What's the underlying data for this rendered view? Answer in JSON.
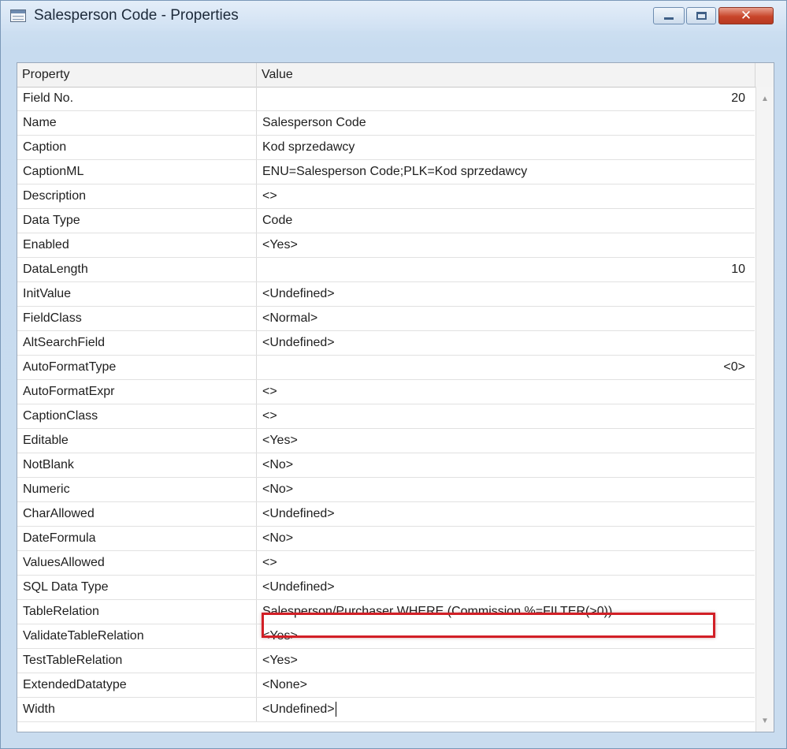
{
  "window": {
    "title": "Salesperson Code - Properties",
    "min_glyph": "minimize",
    "max_glyph": "maximize",
    "close_glyph": "✕"
  },
  "columns": {
    "property": "Property",
    "value": "Value"
  },
  "rows": [
    {
      "property": "Field No.",
      "value": "20",
      "align": "right"
    },
    {
      "property": "Name",
      "value": "Salesperson Code"
    },
    {
      "property": "Caption",
      "value": "Kod sprzedawcy"
    },
    {
      "property": "CaptionML",
      "value": "ENU=Salesperson Code;PLK=Kod sprzedawcy"
    },
    {
      "property": "Description",
      "value": "<>"
    },
    {
      "property": "Data Type",
      "value": "Code"
    },
    {
      "property": "Enabled",
      "value": "<Yes>"
    },
    {
      "property": "DataLength",
      "value": "10",
      "align": "right"
    },
    {
      "property": "InitValue",
      "value": "<Undefined>"
    },
    {
      "property": "FieldClass",
      "value": "<Normal>"
    },
    {
      "property": "AltSearchField",
      "value": "<Undefined>"
    },
    {
      "property": "AutoFormatType",
      "value": "<0>",
      "align": "right"
    },
    {
      "property": "AutoFormatExpr",
      "value": "<>"
    },
    {
      "property": "CaptionClass",
      "value": "<>"
    },
    {
      "property": "Editable",
      "value": "<Yes>"
    },
    {
      "property": "NotBlank",
      "value": "<No>"
    },
    {
      "property": "Numeric",
      "value": "<No>"
    },
    {
      "property": "CharAllowed",
      "value": "<Undefined>"
    },
    {
      "property": "DateFormula",
      "value": "<No>"
    },
    {
      "property": "ValuesAllowed",
      "value": "<>"
    },
    {
      "property": "SQL Data Type",
      "value": "<Undefined>"
    },
    {
      "property": "TableRelation",
      "value": "Salesperson/Purchaser WHERE (Commission %=FILTER(>0))",
      "highlighted": true
    },
    {
      "property": "ValidateTableRelation",
      "value": "<Yes>"
    },
    {
      "property": "TestTableRelation",
      "value": "<Yes>"
    },
    {
      "property": "ExtendedDatatype",
      "value": "<None>"
    },
    {
      "property": "Width",
      "value": "<Undefined>",
      "editing": true
    }
  ],
  "colors": {
    "highlight_border": "#d21f26",
    "close_button": "#c8452b"
  }
}
